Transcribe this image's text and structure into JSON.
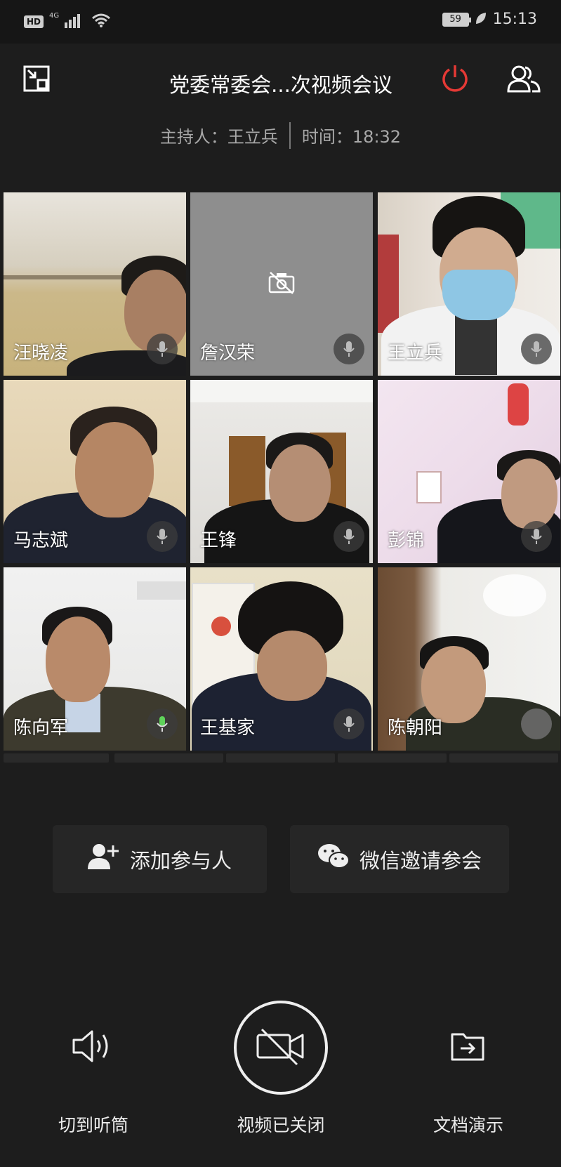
{
  "status_bar": {
    "hd": "HD",
    "network": "4G",
    "battery": "59",
    "time": "15:13"
  },
  "header": {
    "title": "党委常委会...次视频会议",
    "host_label": "主持人：王立兵",
    "time_label": "时间：18:32",
    "icons": [
      "minimize-icon",
      "power-icon",
      "participants-icon"
    ],
    "power_color": "#e53935"
  },
  "participants": [
    {
      "name": "汪晓凌",
      "camera": true,
      "mic": "muted-grey"
    },
    {
      "name": "詹汉荣",
      "camera": false,
      "mic": "muted-grey"
    },
    {
      "name": "王立兵",
      "camera": true,
      "mic": "muted-grey"
    },
    {
      "name": "马志斌",
      "camera": true,
      "mic": "muted-grey"
    },
    {
      "name": "王锋",
      "camera": true,
      "mic": "muted-grey"
    },
    {
      "name": "彭锦",
      "camera": true,
      "mic": "muted-grey"
    },
    {
      "name": "陈向军",
      "camera": true,
      "mic": "speaking-green"
    },
    {
      "name": "王基家",
      "camera": true,
      "mic": "muted-grey"
    },
    {
      "name": "陈朝阳",
      "camera": true,
      "mic": "none"
    }
  ],
  "actions": {
    "add_participant": "添加参与人",
    "wechat_invite": "微信邀请参会"
  },
  "controls": {
    "speaker": "切到听筒",
    "video": "视频已关闭",
    "document": "文档演示"
  }
}
